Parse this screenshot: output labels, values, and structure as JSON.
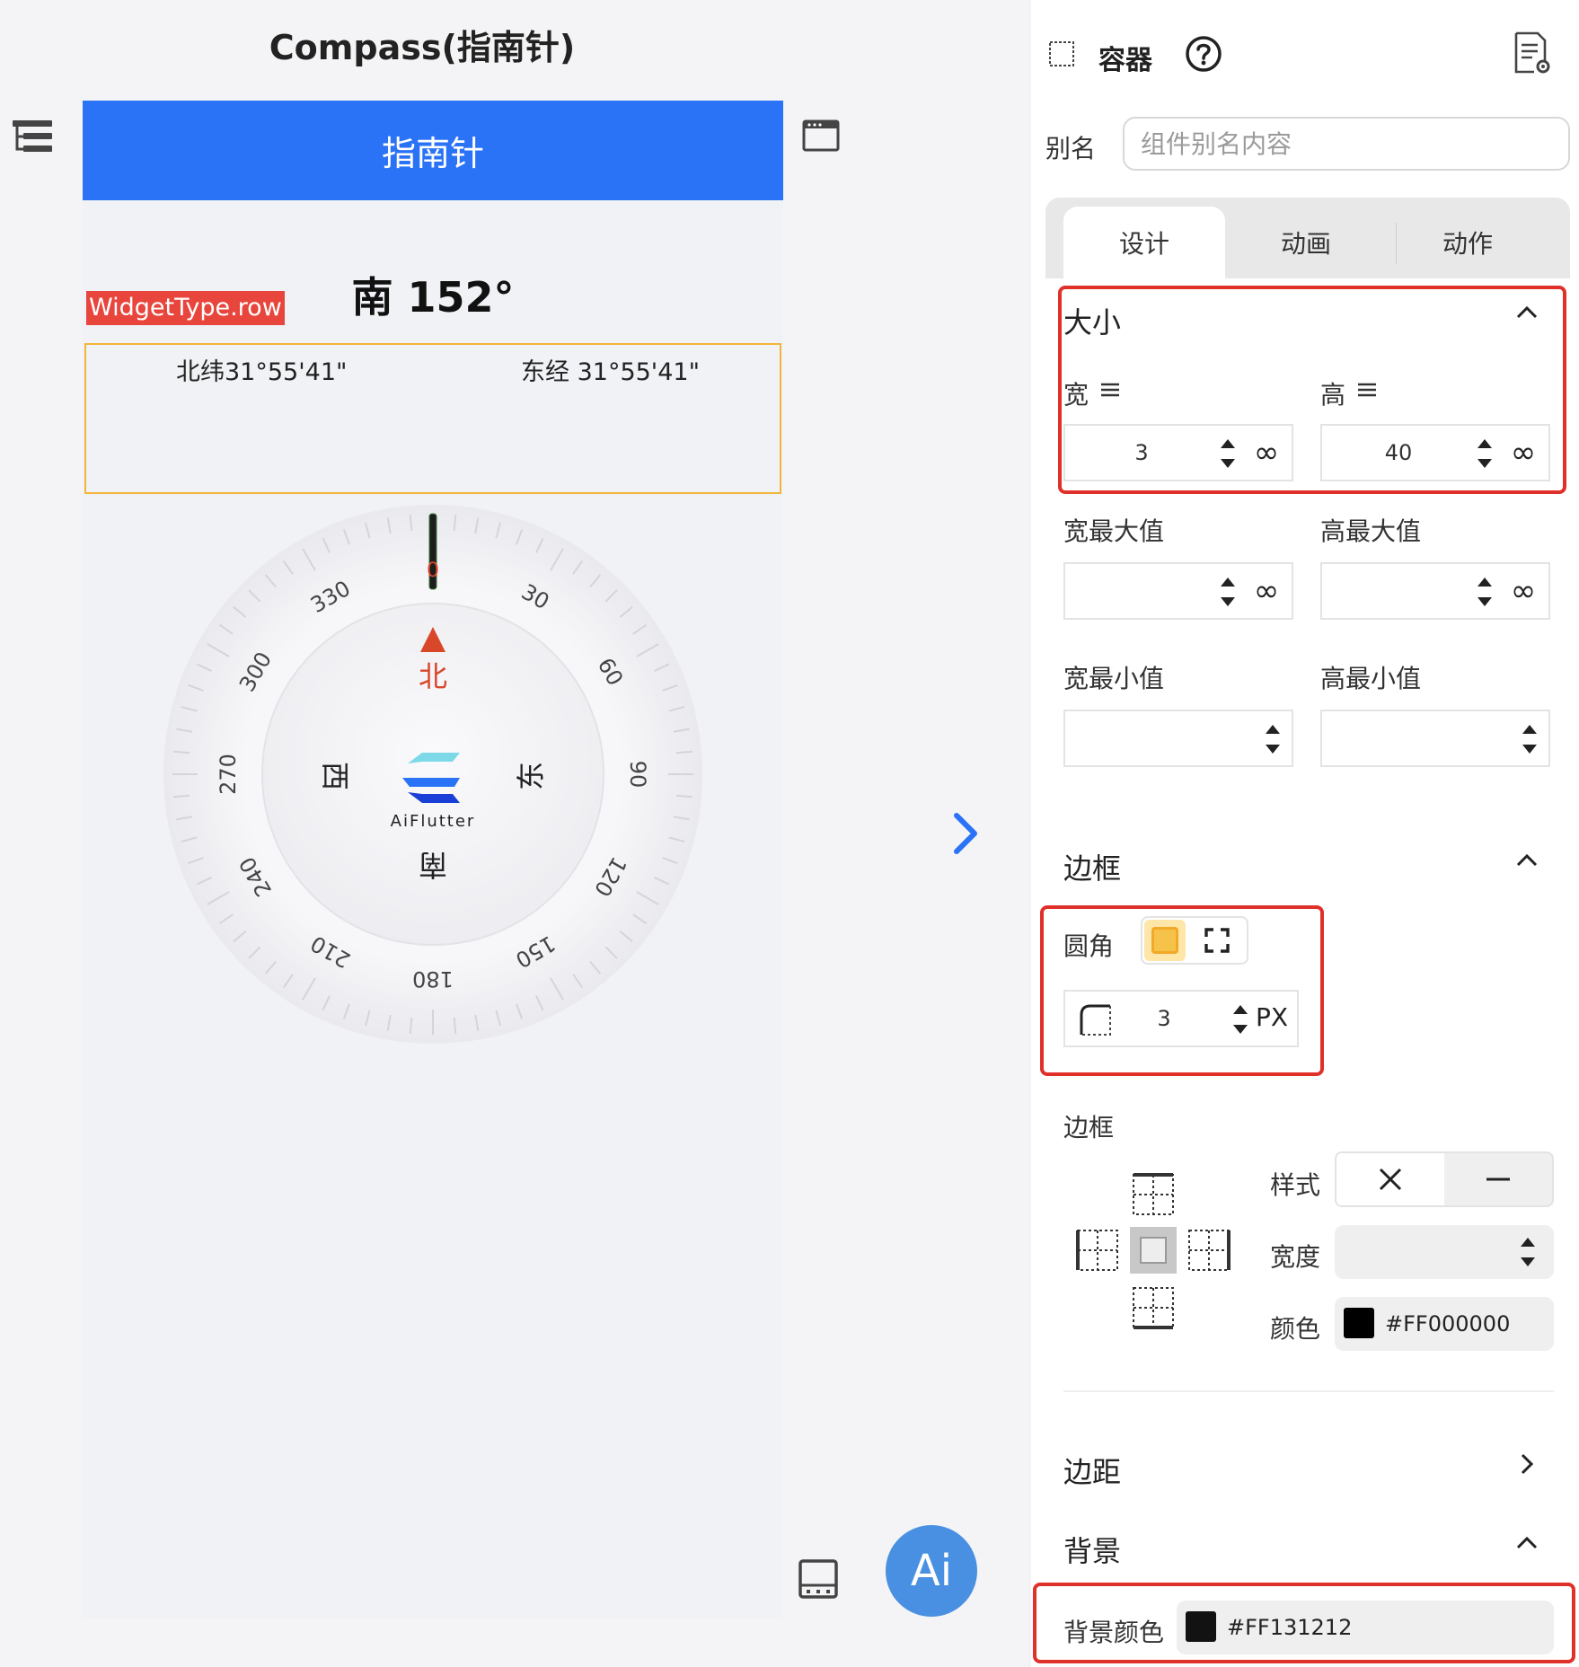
{
  "app": {
    "page_title": "Compass(指南针)",
    "ai_button_label": "Ai"
  },
  "preview": {
    "appbar_title": "指南针",
    "heading": "南 152°",
    "widget_type_tag": "WidgetType.row",
    "latitude": "北纬31°55'41\"",
    "longitude": "东经 31°55'41\"",
    "compass": {
      "needle_label": "0",
      "degree_labels": [
        "330",
        "30",
        "300",
        "60",
        "270",
        "90",
        "240",
        "120",
        "210",
        "150",
        "180"
      ],
      "cardinals": {
        "north": "北",
        "east": "东",
        "south": "南",
        "west": "西"
      },
      "logo_text": "AiFlutter",
      "heading_degrees": 152
    }
  },
  "panel": {
    "header_title": "容器",
    "alias_label": "别名",
    "alias_placeholder": "组件别名内容",
    "tabs": [
      "设计",
      "动画",
      "动作"
    ],
    "active_tab": "设计",
    "size": {
      "title": "大小",
      "width_label": "宽",
      "height_label": "高",
      "width_value": "3",
      "height_value": "40",
      "max_width_label": "宽最大值",
      "max_height_label": "高最大值",
      "min_width_label": "宽最小值",
      "min_height_label": "高最小值",
      "infinity_symbol": "∞"
    },
    "border_section": {
      "title": "边框",
      "radius_label": "圆角",
      "radius_value": "3",
      "radius_unit": "PX",
      "border_label": "边框",
      "style_label": "样式",
      "width_label": "宽度",
      "color_label": "颜色",
      "color_value": "#FF000000"
    },
    "margin_title": "边距",
    "background": {
      "title": "背景",
      "color_label": "背景颜色",
      "color_value": "#FF131212"
    }
  },
  "colors": {
    "appbar": "#2a72f6",
    "widget_tag": "#e8453c",
    "highlight_frame": "#e0302a",
    "row_outline": "#f2b53a",
    "ai_button": "#4a90e2",
    "north_accent": "#d9472b"
  }
}
